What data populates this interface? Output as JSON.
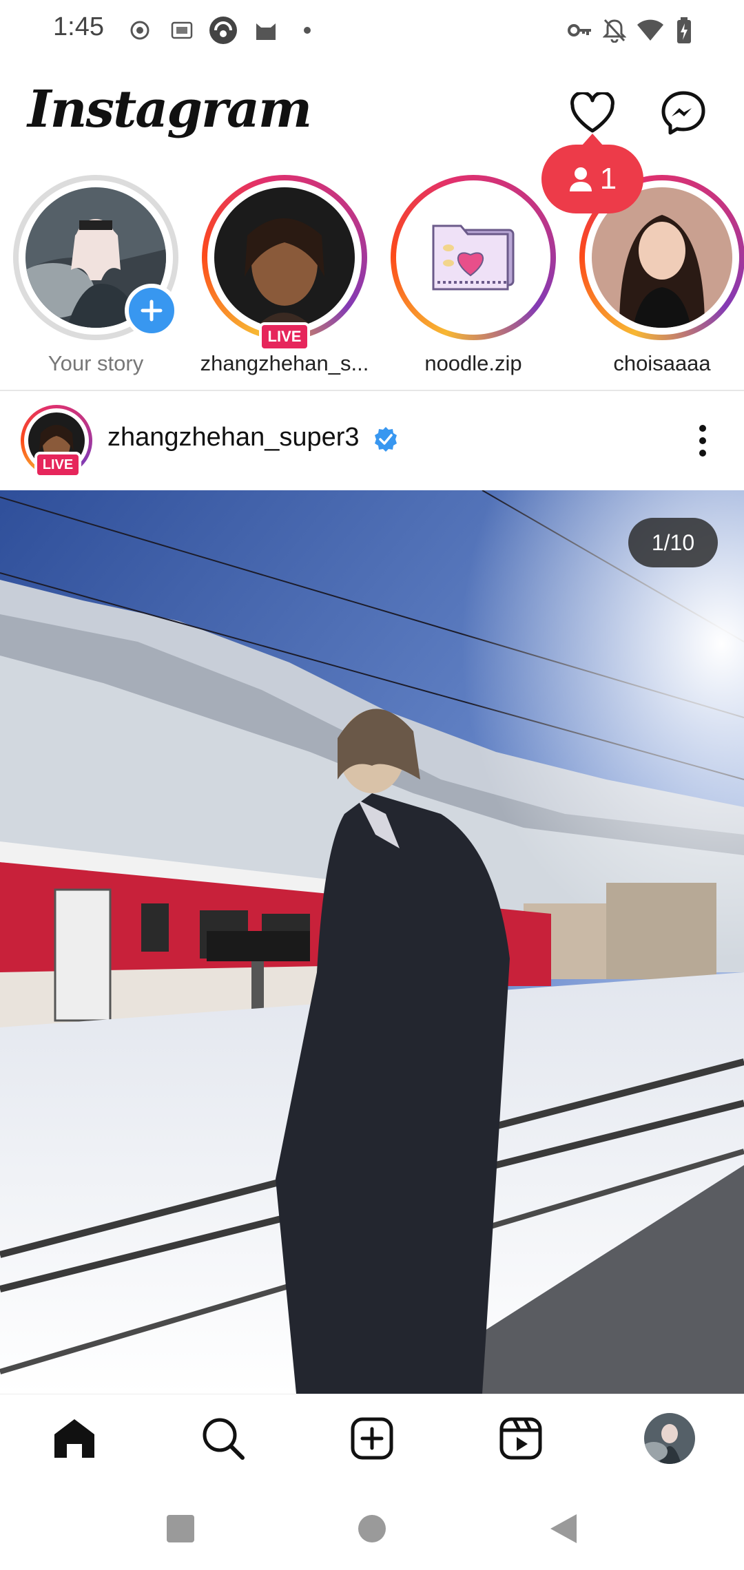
{
  "status_bar": {
    "time": "1:45",
    "left_icons": [
      "record-icon",
      "iqiyi-icon",
      "app-icon",
      "cat-icon",
      "dot-icon"
    ],
    "right_icons": [
      "vpn-key-icon",
      "bell-off-icon",
      "wifi-icon",
      "battery-icon"
    ]
  },
  "header": {
    "logo": "Instagram",
    "notification_count": "1"
  },
  "stories": [
    {
      "label": "Your story",
      "own": true
    },
    {
      "label": "zhangzhehan_s...",
      "live": true,
      "live_label": "LIVE"
    },
    {
      "label": "noodle.zip"
    },
    {
      "label": "choisaaaa"
    }
  ],
  "post": {
    "username": "zhangzhehan_super3",
    "verified": true,
    "live_label": "LIVE",
    "image_counter": "1/10"
  },
  "bottom_nav": [
    "home-icon",
    "search-icon",
    "create-icon",
    "reels-icon",
    "profile-avatar"
  ],
  "colors": {
    "live": "#e6265b",
    "notification": "#ed3b49",
    "verified": "#3897f0",
    "add_story": "#3897f0"
  }
}
